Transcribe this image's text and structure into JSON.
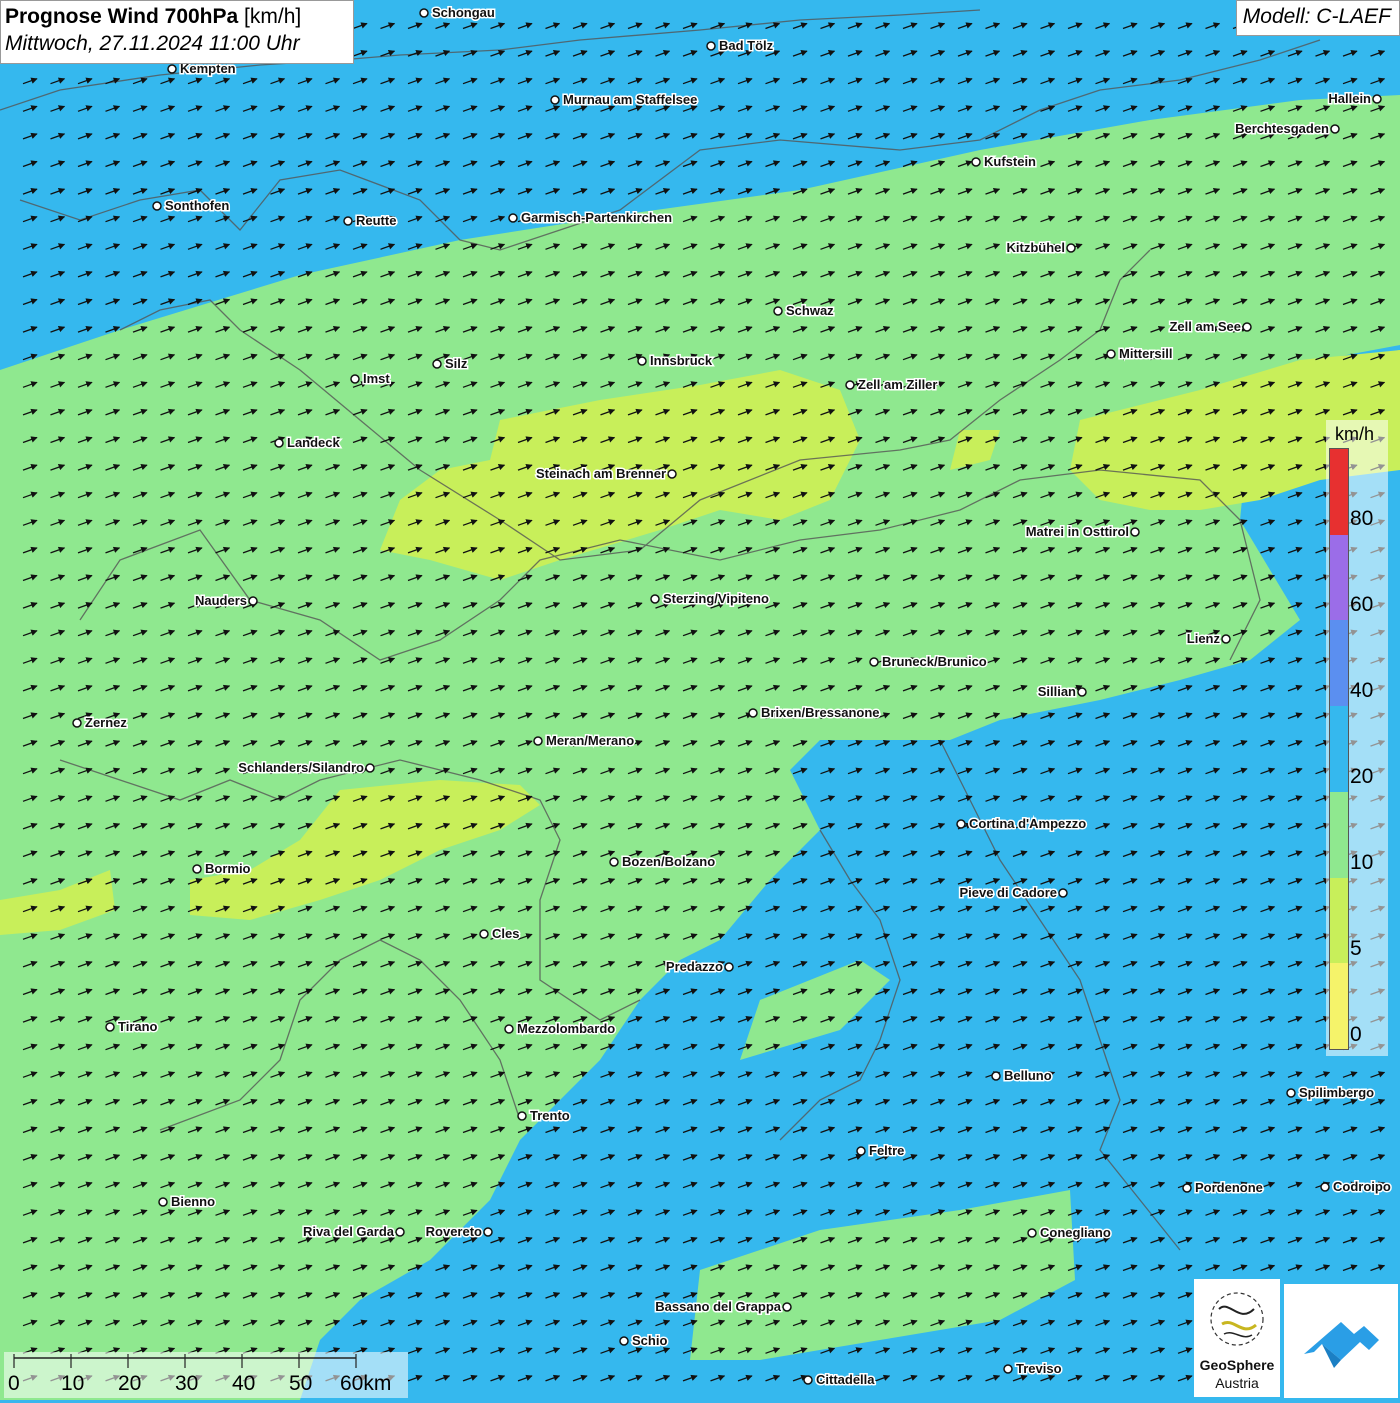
{
  "header": {
    "title_bold": "Prognose Wind 700hPa",
    "title_unit": "[km/h]",
    "datetime": "Mittwoch, 27.11.2024 11:00 Uhr",
    "model": "Modell: C-LAEF"
  },
  "legend": {
    "unit": "km/h",
    "labels": [
      "80",
      "60",
      "40",
      "20",
      "10",
      "5",
      "0"
    ],
    "colors": [
      "#e73030",
      "#9b6de8",
      "#5b8ff0",
      "#35b8ee",
      "#8fe88f",
      "#c8ef5a",
      "#f5f36a"
    ]
  },
  "scale_bar": {
    "labels": [
      "0",
      "10",
      "20",
      "30",
      "40",
      "50",
      "60km"
    ]
  },
  "logo": {
    "name": "GeoSphere",
    "sub": "Austria"
  },
  "colors": {
    "band_lt10": "#35b8ee",
    "band_10_20": "#8fe88f",
    "band_5_10": "#c8ef5a",
    "arrow": "#111111",
    "border": "#555555"
  },
  "wind_arrows": {
    "direction": "east-northeast"
  },
  "cities": [
    {
      "name": "Schongau"
    },
    {
      "name": "Bad Tölz"
    },
    {
      "name": "Kempten"
    },
    {
      "name": "Murnau am Staffelsee"
    },
    {
      "name": "Hallein"
    },
    {
      "name": "Berchtesgaden"
    },
    {
      "name": "Kufstein"
    },
    {
      "name": "Sonthofen"
    },
    {
      "name": "Reutte"
    },
    {
      "name": "Garmisch-Partenkirchen"
    },
    {
      "name": "Kitzbühel"
    },
    {
      "name": "Schwaz"
    },
    {
      "name": "Zell am See"
    },
    {
      "name": "Mittersill"
    },
    {
      "name": "Imst"
    },
    {
      "name": "Silz"
    },
    {
      "name": "Innsbruck"
    },
    {
      "name": "Zell am Ziller"
    },
    {
      "name": "Landeck"
    },
    {
      "name": "Steinach am Brenner"
    },
    {
      "name": "Matrei in Osttirol"
    },
    {
      "name": "Nauders"
    },
    {
      "name": "Sterzing/Vipiteno"
    },
    {
      "name": "Lienz"
    },
    {
      "name": "Bruneck/Brunico"
    },
    {
      "name": "Sillian"
    },
    {
      "name": "Brixen/Bressanone"
    },
    {
      "name": "Zernez"
    },
    {
      "name": "Meran/Merano"
    },
    {
      "name": "Schlanders/Silandro"
    },
    {
      "name": "Cortina d'Ampezzo"
    },
    {
      "name": "Bozen/Bolzano"
    },
    {
      "name": "Bormio"
    },
    {
      "name": "Pieve di Cadore"
    },
    {
      "name": "Cles"
    },
    {
      "name": "Predazzo"
    },
    {
      "name": "Tirano"
    },
    {
      "name": "Mezzolombardo"
    },
    {
      "name": "Belluno"
    },
    {
      "name": "Spilimbergo"
    },
    {
      "name": "Trento"
    },
    {
      "name": "Feltre"
    },
    {
      "name": "Pordenone"
    },
    {
      "name": "Codroipo"
    },
    {
      "name": "Bienno"
    },
    {
      "name": "Riva del Garda"
    },
    {
      "name": "Rovereto"
    },
    {
      "name": "Conegliano"
    },
    {
      "name": "Bassano del Grappa"
    },
    {
      "name": "Schio"
    },
    {
      "name": "Treviso"
    },
    {
      "name": "Cittadella"
    }
  ]
}
